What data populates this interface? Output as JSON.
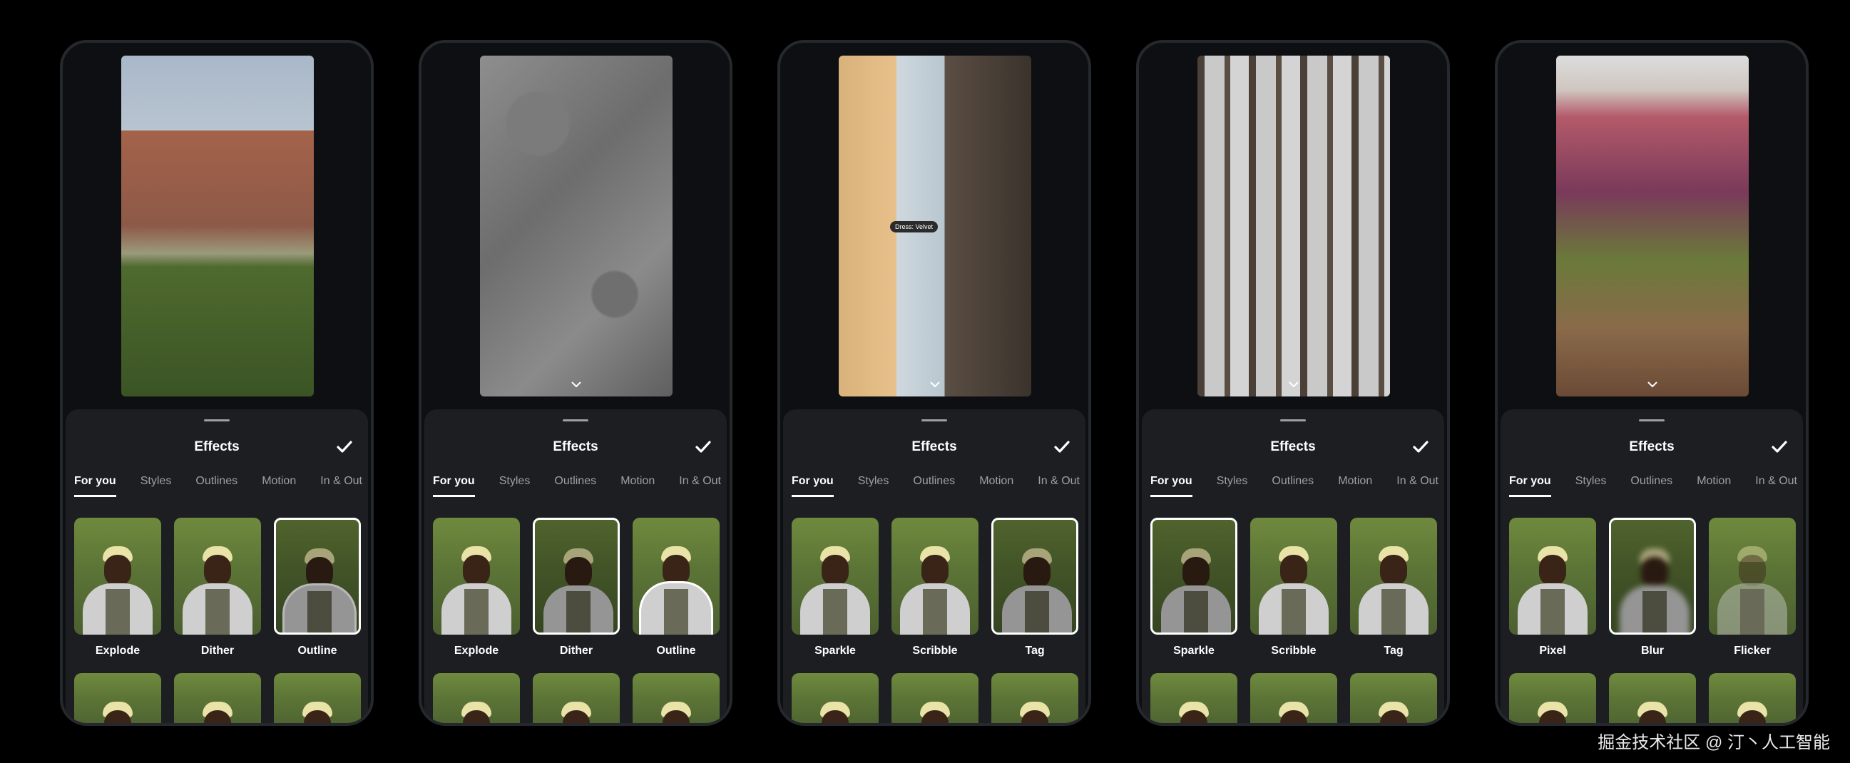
{
  "sheet": {
    "title": "Effects",
    "tabs": [
      "For you",
      "Styles",
      "Outlines",
      "Motion",
      "In & Out"
    ],
    "active_tab": "For you"
  },
  "phones": [
    {
      "scene": "s1",
      "effects": [
        "Explode",
        "Dither",
        "Outline"
      ],
      "selected": 2
    },
    {
      "scene": "s2",
      "effects": [
        "Explode",
        "Dither",
        "Outline"
      ],
      "selected": 1
    },
    {
      "scene": "s3",
      "effects": [
        "Sparkle",
        "Scribble",
        "Tag"
      ],
      "selected": 2,
      "preview_tag": "Dress: Velvet"
    },
    {
      "scene": "s4",
      "effects": [
        "Sparkle",
        "Scribble",
        "Tag"
      ],
      "selected": 0
    },
    {
      "scene": "s5",
      "effects": [
        "Pixel",
        "Blur",
        "Flicker"
      ],
      "selected": 1
    }
  ],
  "watermark": "掘金技术社区 @ 汀丶人工智能",
  "colors": {
    "background": "#000000",
    "sheet": "#1c1e22",
    "selected_border": "#ffffff"
  },
  "icons": {
    "confirm": "checkmark-icon",
    "expand": "chevron-down-icon",
    "sheet": "drag-handle"
  }
}
